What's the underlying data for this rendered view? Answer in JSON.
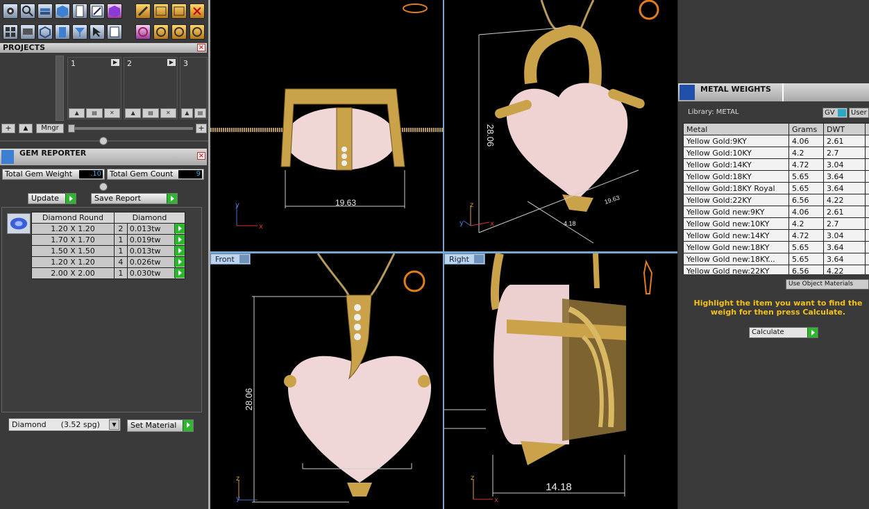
{
  "projects": {
    "title": "PROJECTS",
    "slots": [
      "1",
      "2",
      "3"
    ],
    "mngr_label": "Mngr"
  },
  "gem_reporter": {
    "title": "GEM REPORTER",
    "total_weight_label": "Total Gem Weight",
    "total_weight_value": ".10",
    "total_count_label": "Total Gem Count",
    "total_count_value": "9",
    "update_label": "Update",
    "save_report_label": "Save Report",
    "table_headers": [
      "Diamond Round",
      "Diamond"
    ],
    "rows": [
      {
        "size": "1.20 X 1.20",
        "qty": "2",
        "weight": "0.013tw"
      },
      {
        "size": "1.70 X 1.70",
        "qty": "1",
        "weight": "0.019tw"
      },
      {
        "size": "1.50 X 1.50",
        "qty": "1",
        "weight": "0.013tw"
      },
      {
        "size": "1.20 X 1.20",
        "qty": "4",
        "weight": "0.026tw"
      },
      {
        "size": "2.00 X 2.00",
        "qty": "1",
        "weight": "0.030tw"
      }
    ],
    "material_select": "Diamond      (3.52 spg)",
    "set_material_label": "Set Material"
  },
  "viewports": {
    "top_left": {
      "dimension": "19.63"
    },
    "top_right": {
      "dimension_vertical": "28.06",
      "dimension_diag_a": "19.63",
      "dimension_diag_b": "4.18"
    },
    "bottom_left": {
      "label": "Front",
      "dimension": "28.06"
    },
    "bottom_right": {
      "label": "Right",
      "dimension": "14.18"
    },
    "axes": {
      "x": "x",
      "y": "y",
      "z": "z"
    }
  },
  "metal_weights": {
    "title": "METAL WEIGHTS",
    "library_label": "Library: METAL",
    "gv_label": "GV",
    "user_label": "User",
    "columns": [
      "Metal",
      "Grams",
      "DWT"
    ],
    "rows": [
      {
        "metal": "Yellow Gold:9KY",
        "grams": "4.06",
        "dwt": "2.61"
      },
      {
        "metal": "Yellow Gold:10KY",
        "grams": "4.2",
        "dwt": "2.7"
      },
      {
        "metal": "Yellow Gold:14KY",
        "grams": "4.72",
        "dwt": "3.04"
      },
      {
        "metal": "Yellow Gold:18KY",
        "grams": "5.65",
        "dwt": "3.64"
      },
      {
        "metal": "Yellow Gold:18KY Royal",
        "grams": "5.65",
        "dwt": "3.64"
      },
      {
        "metal": "Yellow Gold:22KY",
        "grams": "6.56",
        "dwt": "4.22"
      },
      {
        "metal": "Yellow Gold new:9KY",
        "grams": "4.06",
        "dwt": "2.61"
      },
      {
        "metal": "Yellow Gold new:10KY",
        "grams": "4.2",
        "dwt": "2.7"
      },
      {
        "metal": "Yellow Gold new:14KY",
        "grams": "4.72",
        "dwt": "3.04"
      },
      {
        "metal": "Yellow Gold new:18KY",
        "grams": "5.65",
        "dwt": "3.64"
      },
      {
        "metal": "Yellow Gold new:18KY...",
        "grams": "5.65",
        "dwt": "3.64"
      },
      {
        "metal": "Yellow Gold new:22KY",
        "grams": "6.56",
        "dwt": "4.22"
      }
    ],
    "use_object_materials": "Use Object Materials",
    "instruction": "Highlight the item you want to find the weigh for then press Calculate.",
    "calculate_label": "Calculate"
  },
  "colors": {
    "accent_green": "#2fb52f",
    "instruction_yellow": "#f2c21b",
    "gold": "#c9a24a",
    "pearl": "#efd3d3"
  }
}
